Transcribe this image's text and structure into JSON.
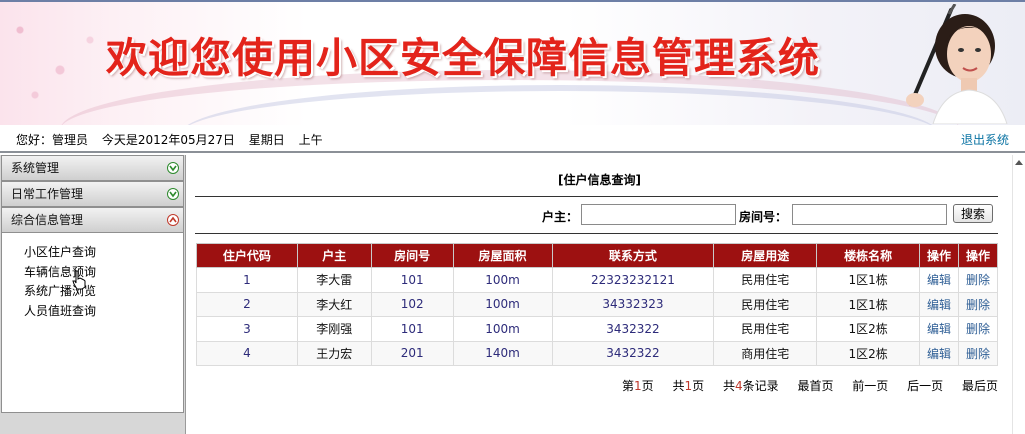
{
  "banner": {
    "title": "欢迎您使用小区安全保障信息管理系统"
  },
  "infobar": {
    "greeting": "您好：管理员",
    "date": "今天是2012年05月27日",
    "weekday": "星期日",
    "period": "上午",
    "logout_label": "退出系统"
  },
  "sidebar": {
    "menus": [
      {
        "label": "系统管理",
        "state": "collapsed"
      },
      {
        "label": "日常工作管理",
        "state": "collapsed"
      },
      {
        "label": "综合信息管理",
        "state": "expanded"
      }
    ],
    "submenu_items": [
      "小区住户查询",
      "车辆信息预询",
      "系统广播浏览",
      "人员值班查询"
    ]
  },
  "main": {
    "page_title": "[住户信息查询]",
    "search": {
      "owner_label": "户主：",
      "owner_value": "",
      "room_label": "房间号：",
      "room_value": "",
      "search_button": "搜索"
    },
    "table": {
      "columns": [
        "住户代码",
        "户主",
        "房间号",
        "房屋面积",
        "联系方式",
        "房屋用途",
        "楼栋名称",
        "操作",
        "操作"
      ],
      "rows": [
        [
          "1",
          "李大雷",
          "101",
          "100m",
          "22323232121",
          "民用住宅",
          "1区1栋",
          "编辑",
          "删除"
        ],
        [
          "2",
          "李大红",
          "102",
          "100m",
          "34332323",
          "民用住宅",
          "1区1栋",
          "编辑",
          "删除"
        ],
        [
          "3",
          "李刚强",
          "101",
          "100m",
          "3432322",
          "民用住宅",
          "1区2栋",
          "编辑",
          "删除"
        ],
        [
          "4",
          "王力宏",
          "201",
          "140m",
          "3432322",
          "商用住宅",
          "1区2栋",
          "编辑",
          "删除"
        ]
      ]
    },
    "pager": {
      "page_prefix": "第",
      "page_num": "1",
      "page_suffix": "页",
      "total_prefix": "共",
      "total_pages": "1",
      "total_suffix": "页",
      "records_prefix": "共",
      "records_num": "4",
      "records_suffix": "条记录",
      "first": "最首页",
      "prev": "前一页",
      "next": "后一页",
      "last": "最后页"
    }
  },
  "colors": {
    "title_red": "#e3241b",
    "table_header": "#9d1111",
    "link_blue": "#0a73a3",
    "sidebar_bg": "#d7d7d7"
  },
  "icons": {
    "menu_toggle_collapsed": "green-down-arrow-circle-icon",
    "menu_toggle_expanded": "red-up-arrow-circle-icon",
    "banner_photo": "woman-with-brush-photo"
  }
}
